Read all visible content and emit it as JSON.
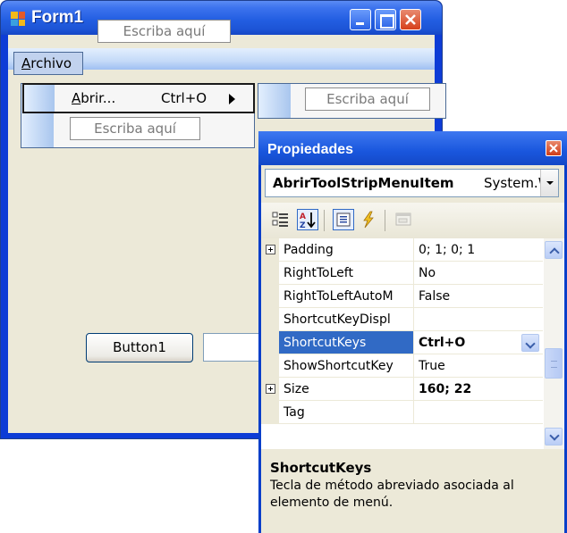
{
  "form": {
    "title": "Form1",
    "menu": {
      "archivo_prefix_u": "A",
      "archivo_rest": "rchivo",
      "type_here": "Escriba aquí"
    },
    "dropdown": {
      "abrir_u": "A",
      "abrir_rest": "brir...",
      "abrir_shortcut": "Ctrl+O",
      "type_here": "Escriba aquí"
    },
    "submenu": {
      "type_here": "Escriba aquí"
    },
    "button1": "Button1"
  },
  "properties": {
    "title": "Propiedades",
    "object_name": "AbrirToolStripMenuItem",
    "object_type": "System.W",
    "rows": [
      {
        "name": "Padding",
        "value": "0; 1; 0; 1",
        "expandable": true,
        "selected": false,
        "bold": false
      },
      {
        "name": "RightToLeft",
        "value": "No",
        "expandable": false,
        "selected": false,
        "bold": false
      },
      {
        "name": "RightToLeftAutoM",
        "value": "False",
        "expandable": false,
        "selected": false,
        "bold": false
      },
      {
        "name": "ShortcutKeyDispl",
        "value": "",
        "expandable": false,
        "selected": false,
        "bold": false
      },
      {
        "name": "ShortcutKeys",
        "value": "Ctrl+O",
        "expandable": false,
        "selected": true,
        "bold": true
      },
      {
        "name": "ShowShortcutKey",
        "value": "True",
        "expandable": false,
        "selected": false,
        "bold": false
      },
      {
        "name": "Size",
        "value": "160; 22",
        "expandable": true,
        "selected": false,
        "bold": true
      },
      {
        "name": "Tag",
        "value": "",
        "expandable": false,
        "selected": false,
        "bold": false
      }
    ],
    "description": {
      "title": "ShortcutKeys",
      "text": "Tecla de método abreviado asociada al elemento de menú."
    }
  }
}
